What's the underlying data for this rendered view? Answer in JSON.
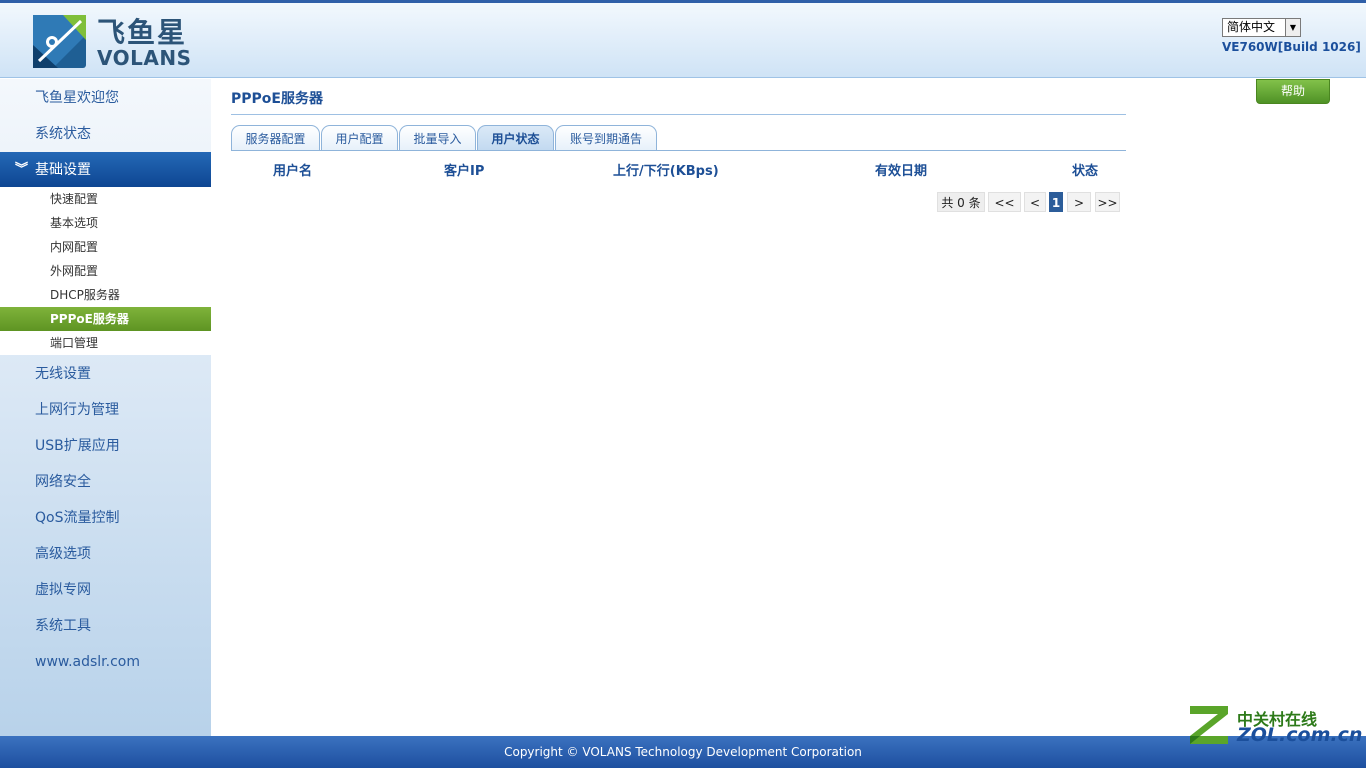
{
  "header": {
    "logo_cn": "飞鱼星",
    "logo_en": "VOLANS",
    "language": "简体中文",
    "version": "VE760W[Build 1026]"
  },
  "sidebar": {
    "items": [
      {
        "label": "飞鱼星欢迎您"
      },
      {
        "label": "系统状态"
      },
      {
        "label": "基础设置"
      },
      {
        "label": "无线设置"
      },
      {
        "label": "上网行为管理"
      },
      {
        "label": "USB扩展应用"
      },
      {
        "label": "网络安全"
      },
      {
        "label": "QoS流量控制"
      },
      {
        "label": "高级选项"
      },
      {
        "label": "虚拟专网"
      },
      {
        "label": "系统工具"
      },
      {
        "label": "www.adslr.com"
      }
    ],
    "sub_items": [
      {
        "label": "快速配置"
      },
      {
        "label": "基本选项"
      },
      {
        "label": "内网配置"
      },
      {
        "label": "外网配置"
      },
      {
        "label": "DHCP服务器"
      },
      {
        "label": "PPPoE服务器"
      },
      {
        "label": "端口管理"
      }
    ]
  },
  "main": {
    "title": "PPPoE服务器",
    "help": "帮助",
    "tabs": [
      {
        "label": "服务器配置"
      },
      {
        "label": "用户配置"
      },
      {
        "label": "批量导入"
      },
      {
        "label": "用户状态"
      },
      {
        "label": "账号到期通告"
      }
    ],
    "active_tab": "用户状态",
    "table": {
      "columns": [
        "用户名",
        "客户IP",
        "上行/下行(KBps)",
        "有效日期",
        "状态"
      ],
      "rows": []
    },
    "pager": {
      "total": "共 0 条",
      "first": "<<",
      "prev": "<",
      "current": "1",
      "next": ">",
      "last": ">>"
    }
  },
  "footer": {
    "copyright": "Copyright © VOLANS Technology Development Corporation"
  },
  "watermark": {
    "cn": "中关村在线",
    "en": "ZOL.com.cn"
  },
  "colors": {
    "brand_blue": "#1d4f96",
    "active_nav": "#0d4591",
    "active_sub": "#6aa22e",
    "help_green": "#5e9e2c"
  }
}
